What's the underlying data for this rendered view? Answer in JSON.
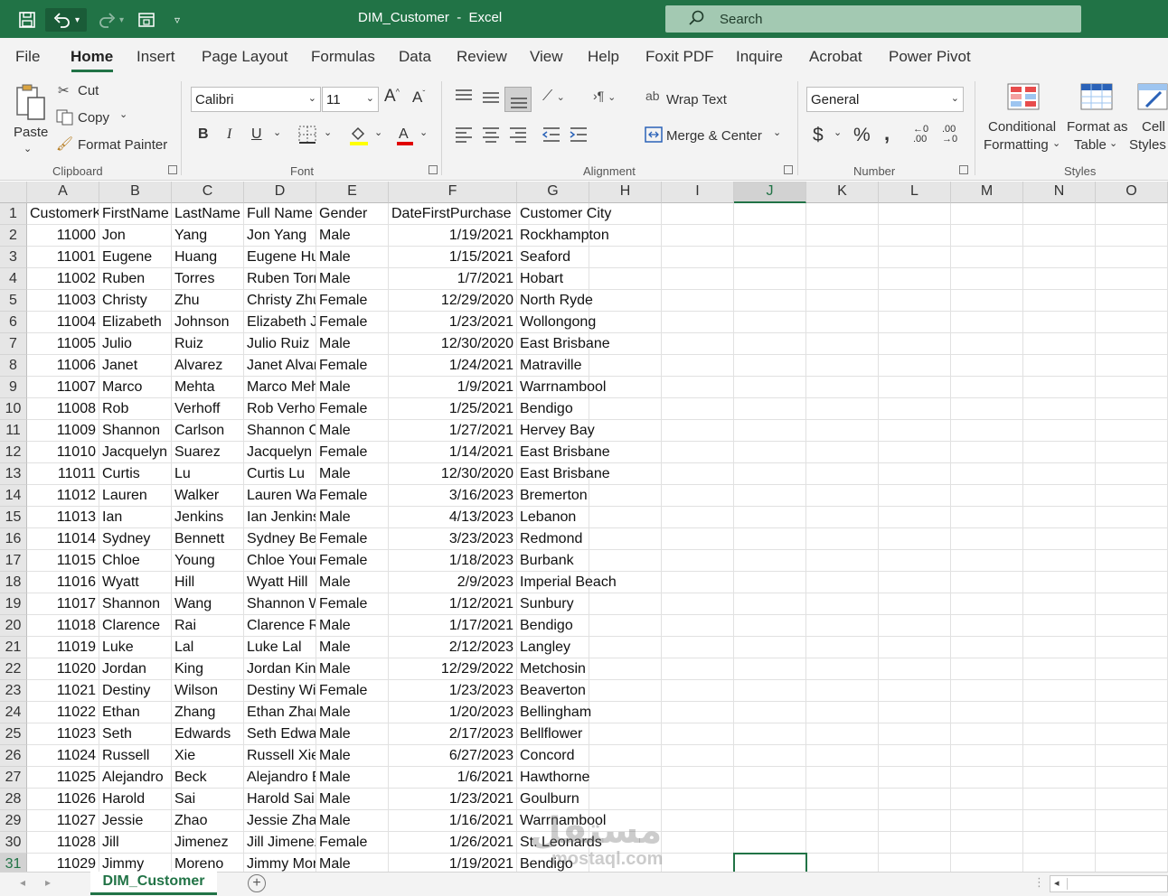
{
  "window": {
    "title": "DIM_Customer  -  Excel",
    "search_placeholder": "Search"
  },
  "menu": [
    "File",
    "Home",
    "Insert",
    "Page Layout",
    "Formulas",
    "Data",
    "Review",
    "View",
    "Help",
    "Foxit PDF",
    "Inquire",
    "Acrobat",
    "Power Pivot"
  ],
  "ribbon": {
    "clipboard": {
      "paste": "Paste",
      "cut": "Cut",
      "copy": "Copy",
      "format_painter": "Format Painter",
      "label": "Clipboard"
    },
    "font": {
      "name": "Calibri",
      "size": "11",
      "label": "Font",
      "bold": "B",
      "italic": "I",
      "underline": "U"
    },
    "alignment": {
      "wrap_text": "Wrap Text",
      "merge_center": "Merge & Center",
      "label": "Alignment"
    },
    "number": {
      "format": "General",
      "label": "Number"
    },
    "styles": {
      "conditional_1": "Conditional",
      "conditional_2": "Formatting",
      "format_table_1": "Format as",
      "format_table_2": "Table",
      "cell_styles_1": "Cell",
      "cell_styles_2": "Styles",
      "label": "Styles"
    }
  },
  "columns": [
    "A",
    "B",
    "C",
    "D",
    "E",
    "F",
    "G",
    "H",
    "I",
    "J",
    "K",
    "L",
    "M",
    "N",
    "O"
  ],
  "headers": [
    "CustomerKey",
    "FirstName",
    "LastName",
    "Full Name",
    "Gender",
    "DateFirstPurchase",
    "Customer City"
  ],
  "rows": [
    [
      "11000",
      "Jon",
      "Yang",
      "Jon Yang",
      "Male",
      "1/19/2021",
      "Rockhampton"
    ],
    [
      "11001",
      "Eugene",
      "Huang",
      "Eugene Huang",
      "Male",
      "1/15/2021",
      "Seaford"
    ],
    [
      "11002",
      "Ruben",
      "Torres",
      "Ruben Torres",
      "Male",
      "1/7/2021",
      "Hobart"
    ],
    [
      "11003",
      "Christy",
      "Zhu",
      "Christy Zhu",
      "Female",
      "12/29/2020",
      "North Ryde"
    ],
    [
      "11004",
      "Elizabeth",
      "Johnson",
      "Elizabeth Johnson",
      "Female",
      "1/23/2021",
      "Wollongong"
    ],
    [
      "11005",
      "Julio",
      "Ruiz",
      "Julio Ruiz",
      "Male",
      "12/30/2020",
      "East Brisbane"
    ],
    [
      "11006",
      "Janet",
      "Alvarez",
      "Janet Alvarez",
      "Female",
      "1/24/2021",
      "Matraville"
    ],
    [
      "11007",
      "Marco",
      "Mehta",
      "Marco Mehta",
      "Male",
      "1/9/2021",
      "Warrnambool"
    ],
    [
      "11008",
      "Rob",
      "Verhoff",
      "Rob Verhoff",
      "Female",
      "1/25/2021",
      "Bendigo"
    ],
    [
      "11009",
      "Shannon",
      "Carlson",
      "Shannon Carlson",
      "Male",
      "1/27/2021",
      "Hervey Bay"
    ],
    [
      "11010",
      "Jacquelyn",
      "Suarez",
      "Jacquelyn Suarez",
      "Female",
      "1/14/2021",
      "East Brisbane"
    ],
    [
      "11011",
      "Curtis",
      "Lu",
      "Curtis Lu",
      "Male",
      "12/30/2020",
      "East Brisbane"
    ],
    [
      "11012",
      "Lauren",
      "Walker",
      "Lauren Walker",
      "Female",
      "3/16/2023",
      "Bremerton"
    ],
    [
      "11013",
      "Ian",
      "Jenkins",
      "Ian Jenkins",
      "Male",
      "4/13/2023",
      "Lebanon"
    ],
    [
      "11014",
      "Sydney",
      "Bennett",
      "Sydney Bennett",
      "Female",
      "3/23/2023",
      "Redmond"
    ],
    [
      "11015",
      "Chloe",
      "Young",
      "Chloe Young",
      "Female",
      "1/18/2023",
      "Burbank"
    ],
    [
      "11016",
      "Wyatt",
      "Hill",
      "Wyatt Hill",
      "Male",
      "2/9/2023",
      "Imperial Beach"
    ],
    [
      "11017",
      "Shannon",
      "Wang",
      "Shannon Wang",
      "Female",
      "1/12/2021",
      "Sunbury"
    ],
    [
      "11018",
      "Clarence",
      "Rai",
      "Clarence Rai",
      "Male",
      "1/17/2021",
      "Bendigo"
    ],
    [
      "11019",
      "Luke",
      "Lal",
      "Luke Lal",
      "Male",
      "2/12/2023",
      "Langley"
    ],
    [
      "11020",
      "Jordan",
      "King",
      "Jordan King",
      "Male",
      "12/29/2022",
      "Metchosin"
    ],
    [
      "11021",
      "Destiny",
      "Wilson",
      "Destiny Wilson",
      "Female",
      "1/23/2023",
      "Beaverton"
    ],
    [
      "11022",
      "Ethan",
      "Zhang",
      "Ethan Zhang",
      "Male",
      "1/20/2023",
      "Bellingham"
    ],
    [
      "11023",
      "Seth",
      "Edwards",
      "Seth Edwards",
      "Male",
      "2/17/2023",
      "Bellflower"
    ],
    [
      "11024",
      "Russell",
      "Xie",
      "Russell Xie",
      "Male",
      "6/27/2023",
      "Concord"
    ],
    [
      "11025",
      "Alejandro",
      "Beck",
      "Alejandro Beck",
      "Male",
      "1/6/2021",
      "Hawthorne"
    ],
    [
      "11026",
      "Harold",
      "Sai",
      "Harold Sai",
      "Male",
      "1/23/2021",
      "Goulburn"
    ],
    [
      "11027",
      "Jessie",
      "Zhao",
      "Jessie Zhao",
      "Male",
      "1/16/2021",
      "Warrnambool"
    ],
    [
      "11028",
      "Jill",
      "Jimenez",
      "Jill Jimenez",
      "Female",
      "1/26/2021",
      "St. Leonards"
    ],
    [
      "11029",
      "Jimmy",
      "Moreno",
      "Jimmy Moreno",
      "Male",
      "1/19/2021",
      "Bendigo"
    ]
  ],
  "sheet_tab": "DIM_Customer",
  "watermark": {
    "arabic": "مستقل",
    "latin": "mostaql.com"
  },
  "colors": {
    "accent": "#217346",
    "search_bg": "#a3c9b2"
  }
}
